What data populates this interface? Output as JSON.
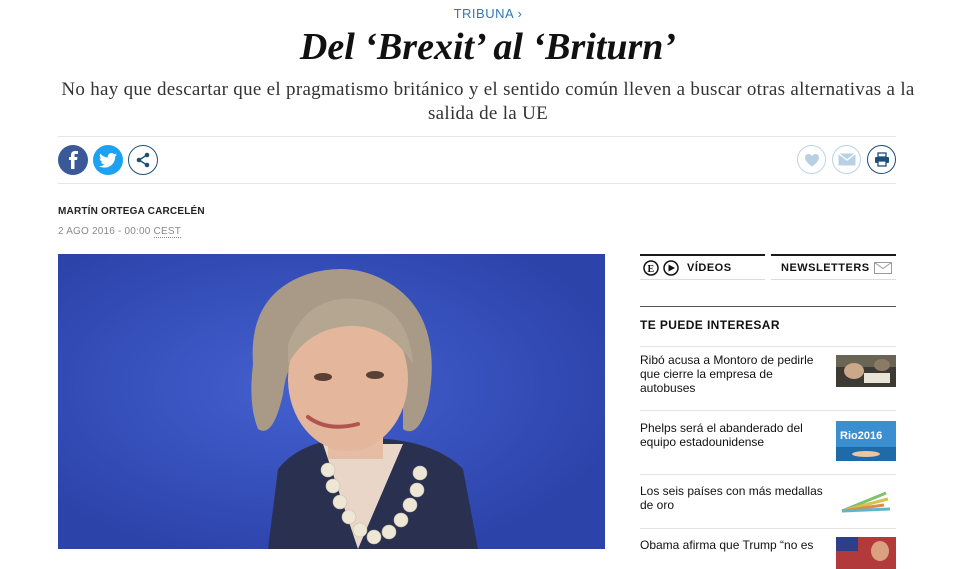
{
  "section": {
    "label": "TRIBUNA ›"
  },
  "article": {
    "title": "Del ‘Brexit’ al ‘Briturn’",
    "subtitle": "No hay que descartar que el pragmatismo británico y el sentido común lleven a buscar otras alternativas a la salida de la UE",
    "author": "MARTÍN ORTEGA CARCELÉN",
    "date": "2 AGO 2016 - 00:00",
    "timezone": "CEST"
  },
  "share": {
    "facebook_icon": "facebook-icon",
    "twitter_icon": "twitter-icon",
    "share_icon": "share-icon",
    "favorite_icon": "heart-icon",
    "email_icon": "envelope-icon",
    "print_icon": "printer-icon"
  },
  "colors": {
    "accent": "#2f7ab8",
    "facebook": "#3b5998",
    "twitter": "#1da1f2"
  },
  "sidebar": {
    "videos_label": "VÍDEOS",
    "newsletters_label": "NEWSLETTERS",
    "heading": "TE PUEDE INTERESAR",
    "items": [
      {
        "text": "Ribó acusa a Montoro de pedirle que cierre la empresa de autobuses"
      },
      {
        "text": "Phelps será el abanderado del equipo estadounidense",
        "thumb_text": "Rio2016"
      },
      {
        "text": "Los seis países con más medallas de oro"
      },
      {
        "text": "Obama afirma que Trump “no es"
      }
    ]
  }
}
